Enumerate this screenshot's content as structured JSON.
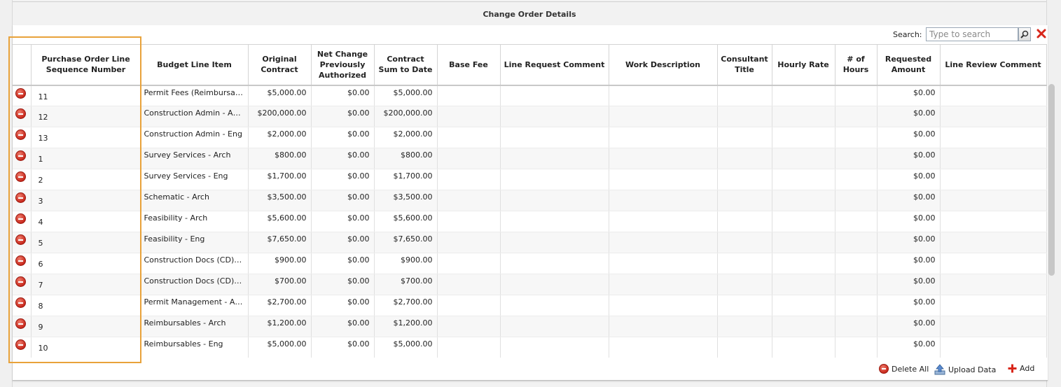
{
  "panel": {
    "title": "Change Order Details"
  },
  "search": {
    "label": "Search:",
    "placeholder": "Type to search"
  },
  "columns": [
    "",
    "Purchase Order Line Sequence Number",
    "Budget Line Item",
    "Original Contract",
    "Net Change Previously Authorized",
    "Contract Sum to Date",
    "Base Fee",
    "Line Request Comment",
    "Work Description",
    "Consultant Title",
    "Hourly Rate",
    "# of Hours",
    "Requested Amount",
    "Line Review Comment"
  ],
  "rows": [
    {
      "seq": "11",
      "item": "Permit Fees (Reimbursable)...",
      "original": "$5,000.00",
      "net": "$0.00",
      "sum": "$5,000.00",
      "requested": "$0.00"
    },
    {
      "seq": "12",
      "item": "Construction Admin - Arch",
      "original": "$200,000.00",
      "net": "$0.00",
      "sum": "$200,000.00",
      "requested": "$0.00"
    },
    {
      "seq": "13",
      "item": "Construction Admin - Eng",
      "original": "$2,000.00",
      "net": "$0.00",
      "sum": "$2,000.00",
      "requested": "$0.00"
    },
    {
      "seq": "1",
      "item": "Survey Services - Arch",
      "original": "$800.00",
      "net": "$0.00",
      "sum": "$800.00",
      "requested": "$0.00"
    },
    {
      "seq": "2",
      "item": "Survey Services - Eng",
      "original": "$1,700.00",
      "net": "$0.00",
      "sum": "$1,700.00",
      "requested": "$0.00"
    },
    {
      "seq": "3",
      "item": "Schematic - Arch",
      "original": "$3,500.00",
      "net": "$0.00",
      "sum": "$3,500.00",
      "requested": "$0.00"
    },
    {
      "seq": "4",
      "item": "Feasibility - Arch",
      "original": "$5,600.00",
      "net": "$0.00",
      "sum": "$5,600.00",
      "requested": "$0.00"
    },
    {
      "seq": "5",
      "item": "Feasibility - Eng",
      "original": "$7,650.00",
      "net": "$0.00",
      "sum": "$7,650.00",
      "requested": "$0.00"
    },
    {
      "seq": "6",
      "item": "Construction Docs (CD) - A...",
      "original": "$900.00",
      "net": "$0.00",
      "sum": "$900.00",
      "requested": "$0.00"
    },
    {
      "seq": "7",
      "item": "Construction Docs (CD) - Eng",
      "original": "$700.00",
      "net": "$0.00",
      "sum": "$700.00",
      "requested": "$0.00"
    },
    {
      "seq": "8",
      "item": "Permit Management - Arch",
      "original": "$2,700.00",
      "net": "$0.00",
      "sum": "$2,700.00",
      "requested": "$0.00"
    },
    {
      "seq": "9",
      "item": "Reimbursables - Arch",
      "original": "$1,200.00",
      "net": "$0.00",
      "sum": "$1,200.00",
      "requested": "$0.00"
    },
    {
      "seq": "10",
      "item": "Reimbursables - Eng",
      "original": "$5,000.00",
      "net": "$0.00",
      "sum": "$5,000.00",
      "requested": "$0.00"
    }
  ],
  "footer": {
    "delete_all": "Delete All",
    "upload": "Upload Data",
    "add": "Add"
  },
  "colors": {
    "highlight": "#e8a23a",
    "delete_red": "#c8281c"
  },
  "icons": {
    "search": "magnifier-icon",
    "clear": "red-x-icon",
    "row_delete": "minus-circle-icon",
    "upload": "upload-icon",
    "add": "plus-icon"
  }
}
